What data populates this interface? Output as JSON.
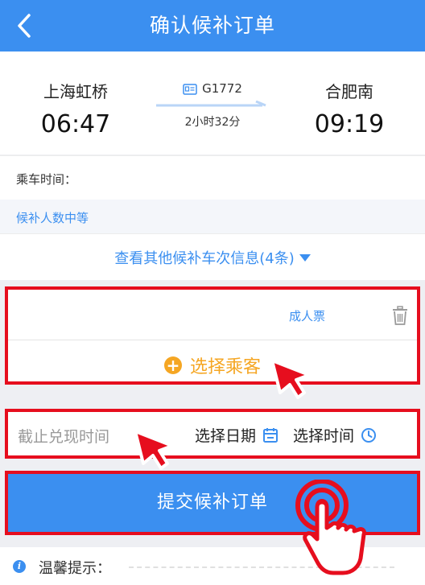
{
  "header": {
    "title": "确认候补订单",
    "back_icon": "chevron-left-icon",
    "background": "#3b8ff0"
  },
  "train": {
    "from_station": "上海虹桥",
    "from_time": "06:47",
    "to_station": "合肥南",
    "to_time": "09:19",
    "train_number": "G1772",
    "duration": "2小时32分"
  },
  "ride_time": {
    "label": "乘车时间："
  },
  "waitlist_count": {
    "label": "候补人数中等"
  },
  "other_trains": {
    "label": "查看其他候补车次信息(4条)",
    "icon": "caret-down-icon"
  },
  "passenger": {
    "ticket_type": "成人票",
    "delete_icon": "trash-icon",
    "select_label": "选择乘客",
    "accent": "#f5a623"
  },
  "deadline": {
    "label": "截止兑现时间",
    "date_label": "选择日期",
    "time_label": "选择时间"
  },
  "submit": {
    "label": "提交候补订单"
  },
  "tips": {
    "label": "温馨提示："
  },
  "colors": {
    "accent_blue": "#3b8ff0",
    "highlight_red": "#e60e1e"
  }
}
